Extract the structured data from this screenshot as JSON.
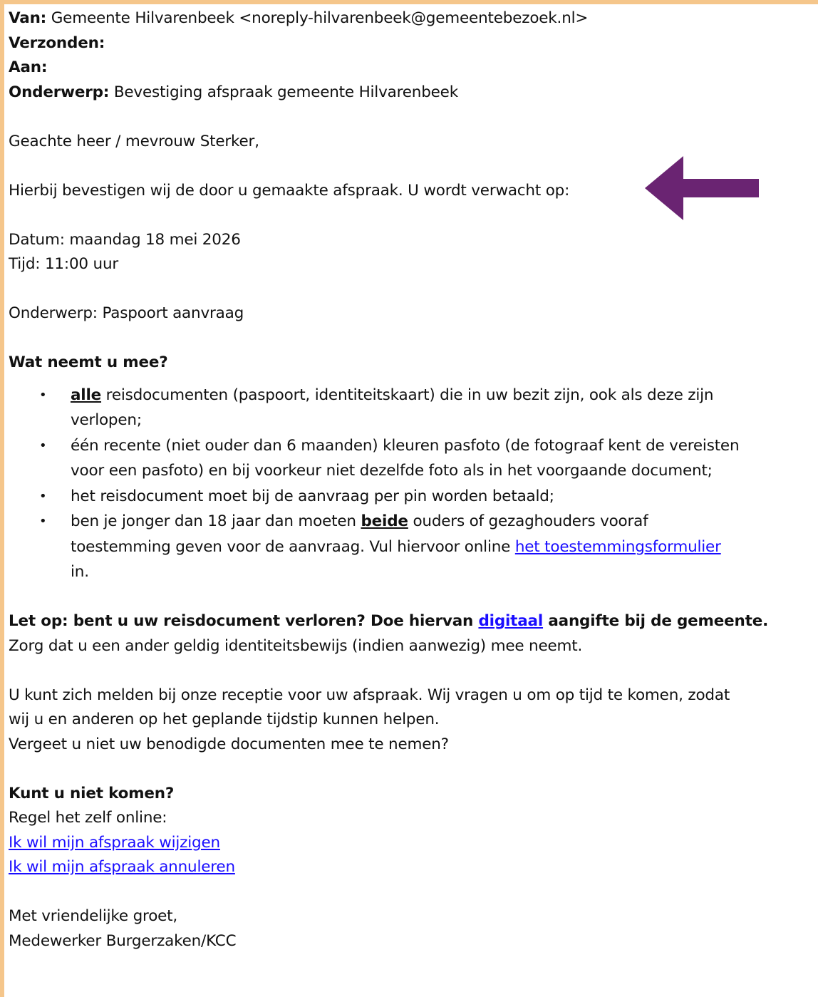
{
  "header": {
    "from_label": "Van:",
    "from_value": "Gemeente Hilvarenbeek <noreply-hilvarenbeek@gemeentebezoek.nl>",
    "sent_label": "Verzonden:",
    "to_label": "Aan:",
    "subject_label": "Onderwerp:",
    "subject_value": "Bevestiging afspraak gemeente Hilvarenbeek"
  },
  "body": {
    "greeting": "Geachte heer / mevrouw Sterker,",
    "intro": "Hierbij bevestigen wij de door u gemaakte afspraak. U wordt verwacht op:",
    "date": "Datum: maandag 18 mei 2026",
    "time": "Tijd: 11:00 uur",
    "topic": "Onderwerp: Paspoort aanvraag",
    "bring_heading": "Wat neemt u mee?",
    "bullets": {
      "b1_bold": "alle",
      "b1_rest_line1": " reisdocumenten (paspoort, identiteitskaart) die in uw bezit zijn, ook als deze zijn",
      "b1_line2": "verlopen;",
      "b2_line1": "één recente (niet ouder dan 6 maanden) kleuren pasfoto (de fotograaf kent de vereisten",
      "b2_line2": "voor een pasfoto) en bij voorkeur niet dezelfde foto als in het voorgaande document;",
      "b3": "het reisdocument moet bij de aanvraag per pin worden betaald;",
      "b4_pre": "ben je jonger dan 18 jaar dan moeten ",
      "b4_bold": "beide",
      "b4_post": " ouders of gezaghouders vooraf",
      "b4_line2_pre": "toestemming geven voor de aanvraag. Vul hiervoor online ",
      "b4_link": "het toestemmingsformulier",
      "b4_line3": "in."
    },
    "lost_pre": "Let op: bent u uw reisdocument verloren? Doe hiervan ",
    "lost_link": "digitaal",
    "lost_post": " aangifte bij de gemeente.",
    "lost_line2": "Zorg dat u een ander geldig identiteitsbewijs (indien aanwezig) mee neemt.",
    "report_line1": "U kunt zich melden bij onze receptie voor uw afspraak. Wij vragen u om op tijd te komen, zodat",
    "report_line2": "wij u en anderen op het geplande tijdstip kunnen helpen.",
    "report_line3": "Vergeet u niet uw benodigde documenten mee te nemen?",
    "cant_come_heading": "Kunt u niet komen?",
    "online_text": "Regel het zelf online:",
    "link_change": "Ik wil mijn afspraak wijzigen",
    "link_cancel": "Ik wil mijn afspraak annuleren",
    "closing": "Met vriendelijke groet,",
    "signature": "Medewerker Burgerzaken/KCC",
    "bullet_glyph": "•"
  },
  "colors": {
    "frame": "#f5c68b",
    "link": "#1a0dff",
    "arrow": "#6a2472"
  },
  "icons": {
    "arrow": "left-arrow-icon"
  }
}
